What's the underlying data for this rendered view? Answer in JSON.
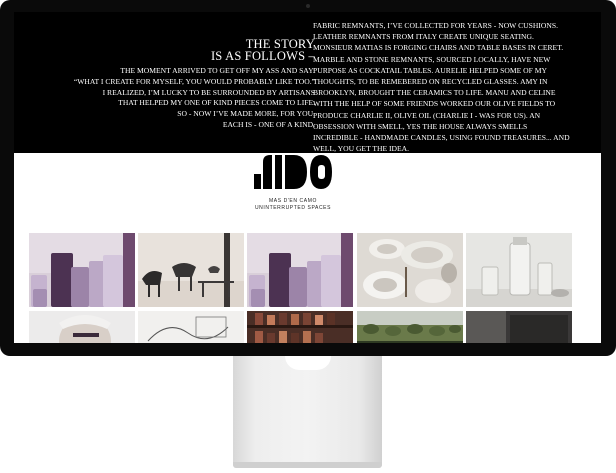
{
  "story": {
    "heading": [
      "THE STORY",
      "IS AS FOLLOWS –"
    ],
    "intro": [
      "THE MOMENT ARRIVED TO GET OFF MY ASS AND SAY:",
      "“WHAT I CREATE FOR MYSELF, YOU WOULD PROBABLY LIKE TOO.”",
      "I REALIZED, I’M LUCKY TO BE SURROUNDED BY ARTISANS",
      "THAT HELPED MY ONE OF KIND PIECES COME TO LIFE.",
      "SO - NOW I’VE MADE MORE, FOR YOU.",
      "EACH IS - ONE OF A KIND."
    ],
    "body": [
      "FABRIC REMNANTS, I’VE COLLECTED FOR YEARS - NOW CUSHIONS.",
      "LEATHER REMNANTS FROM ITALY CREATE UNIQUE SEATING.",
      "MONSIEUR MATIAS IS FORGING CHAIRS AND TABLE BASES IN CERET.",
      "MARBLE AND STONE REMNANTS, SOURCED LOCALLY, HAVE NEW",
      "PURPOSE AS COCKATAIL TABLES. AURELIE HELPED SOME OF MY",
      "THOUGHTS, TO BE REMEBERED ON RECYCLED GLASSES. AMY IN",
      "BROOKLYN, BROUGHT THE CERAMICS TO LIFE. MANU AND CELINE",
      "WITH THE HELP OF SOME FRIENDS WORKED OUR OLIVE FIELDS TO",
      "PRODUCE CHARLIE II, OLIVE OIL (CHARLIE I - WAS FOR US). AN",
      "OBSESSION WITH SMELL, YES THE HOUSE ALWAYS SMELLS",
      "INCREDIBLE - HANDMADE CANDLES, USING FOUND TREASURES... AND",
      "WELL, YOU GET THE IDEA."
    ]
  },
  "brand": {
    "logo_text": "NIDO",
    "name": "MAS D'EN CAMO",
    "tagline": "UNINTERRUPTED SPACES"
  },
  "gallery": [
    {
      "name": "gallery-candles-1",
      "kind": "candles"
    },
    {
      "name": "gallery-chairs",
      "kind": "chairs"
    },
    {
      "name": "gallery-candles-2",
      "kind": "candles"
    },
    {
      "name": "gallery-ceramics",
      "kind": "ceramics"
    },
    {
      "name": "gallery-glassware",
      "kind": "glass"
    },
    {
      "name": "gallery-portrait",
      "kind": "portrait"
    },
    {
      "name": "gallery-sketch",
      "kind": "sketch"
    },
    {
      "name": "gallery-spice-shelf",
      "kind": "shelf"
    },
    {
      "name": "gallery-olive-field",
      "kind": "field"
    },
    {
      "name": "gallery-dark-interior",
      "kind": "dark"
    }
  ],
  "colors": {
    "bezel": "#0a0a0a",
    "text": "#ffffff",
    "candle_lilac": "#b7a2c4",
    "candle_plum": "#5b3b5e",
    "background": "#ffffff"
  }
}
